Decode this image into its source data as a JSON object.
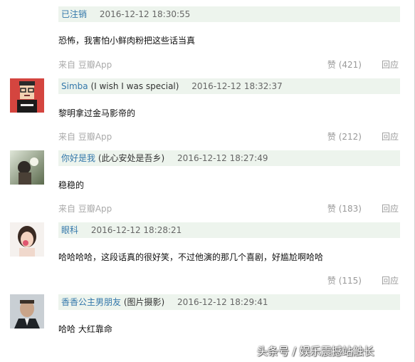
{
  "comments": [
    {
      "username": "已注销",
      "signature": "",
      "timestamp": "2016-12-12 18:30:55",
      "text": "恐怖，我害怕小鲜肉粉把这些话当真",
      "source": "来自 豆瓣App",
      "likes": "赞 (421)",
      "reply": "回应"
    },
    {
      "username": "Simba",
      "signature": "(I wish I was special)",
      "timestamp": "2016-12-12 18:32:37",
      "text": "黎明拿过金马影帝的",
      "source": "来自 豆瓣App",
      "likes": "赞 (212)",
      "reply": "回应"
    },
    {
      "username": "你好是我",
      "signature": "(此心安处是吾乡)",
      "timestamp": "2016-12-12 18:27:49",
      "text": "稳稳的",
      "source": "来自 豆瓣App",
      "likes": "赞 (183)",
      "reply": "回应"
    },
    {
      "username": "眼科",
      "signature": "",
      "timestamp": "2016-12-12 18:28:21",
      "text": "哈哈哈哈，这段话真的很好笑，不过他演的那几个喜剧，好尴尬啊哈哈",
      "source": "",
      "likes": "赞 (115)",
      "reply": "回应"
    },
    {
      "username": "香香公主男朋友",
      "signature": "(图片摄影)",
      "timestamp": "2016-12-12 18:29:41",
      "text": "哈哈 大红靠命",
      "source": "",
      "likes": "",
      "reply": ""
    }
  ],
  "watermark": "头条号 / 娱乐震撼站触长"
}
